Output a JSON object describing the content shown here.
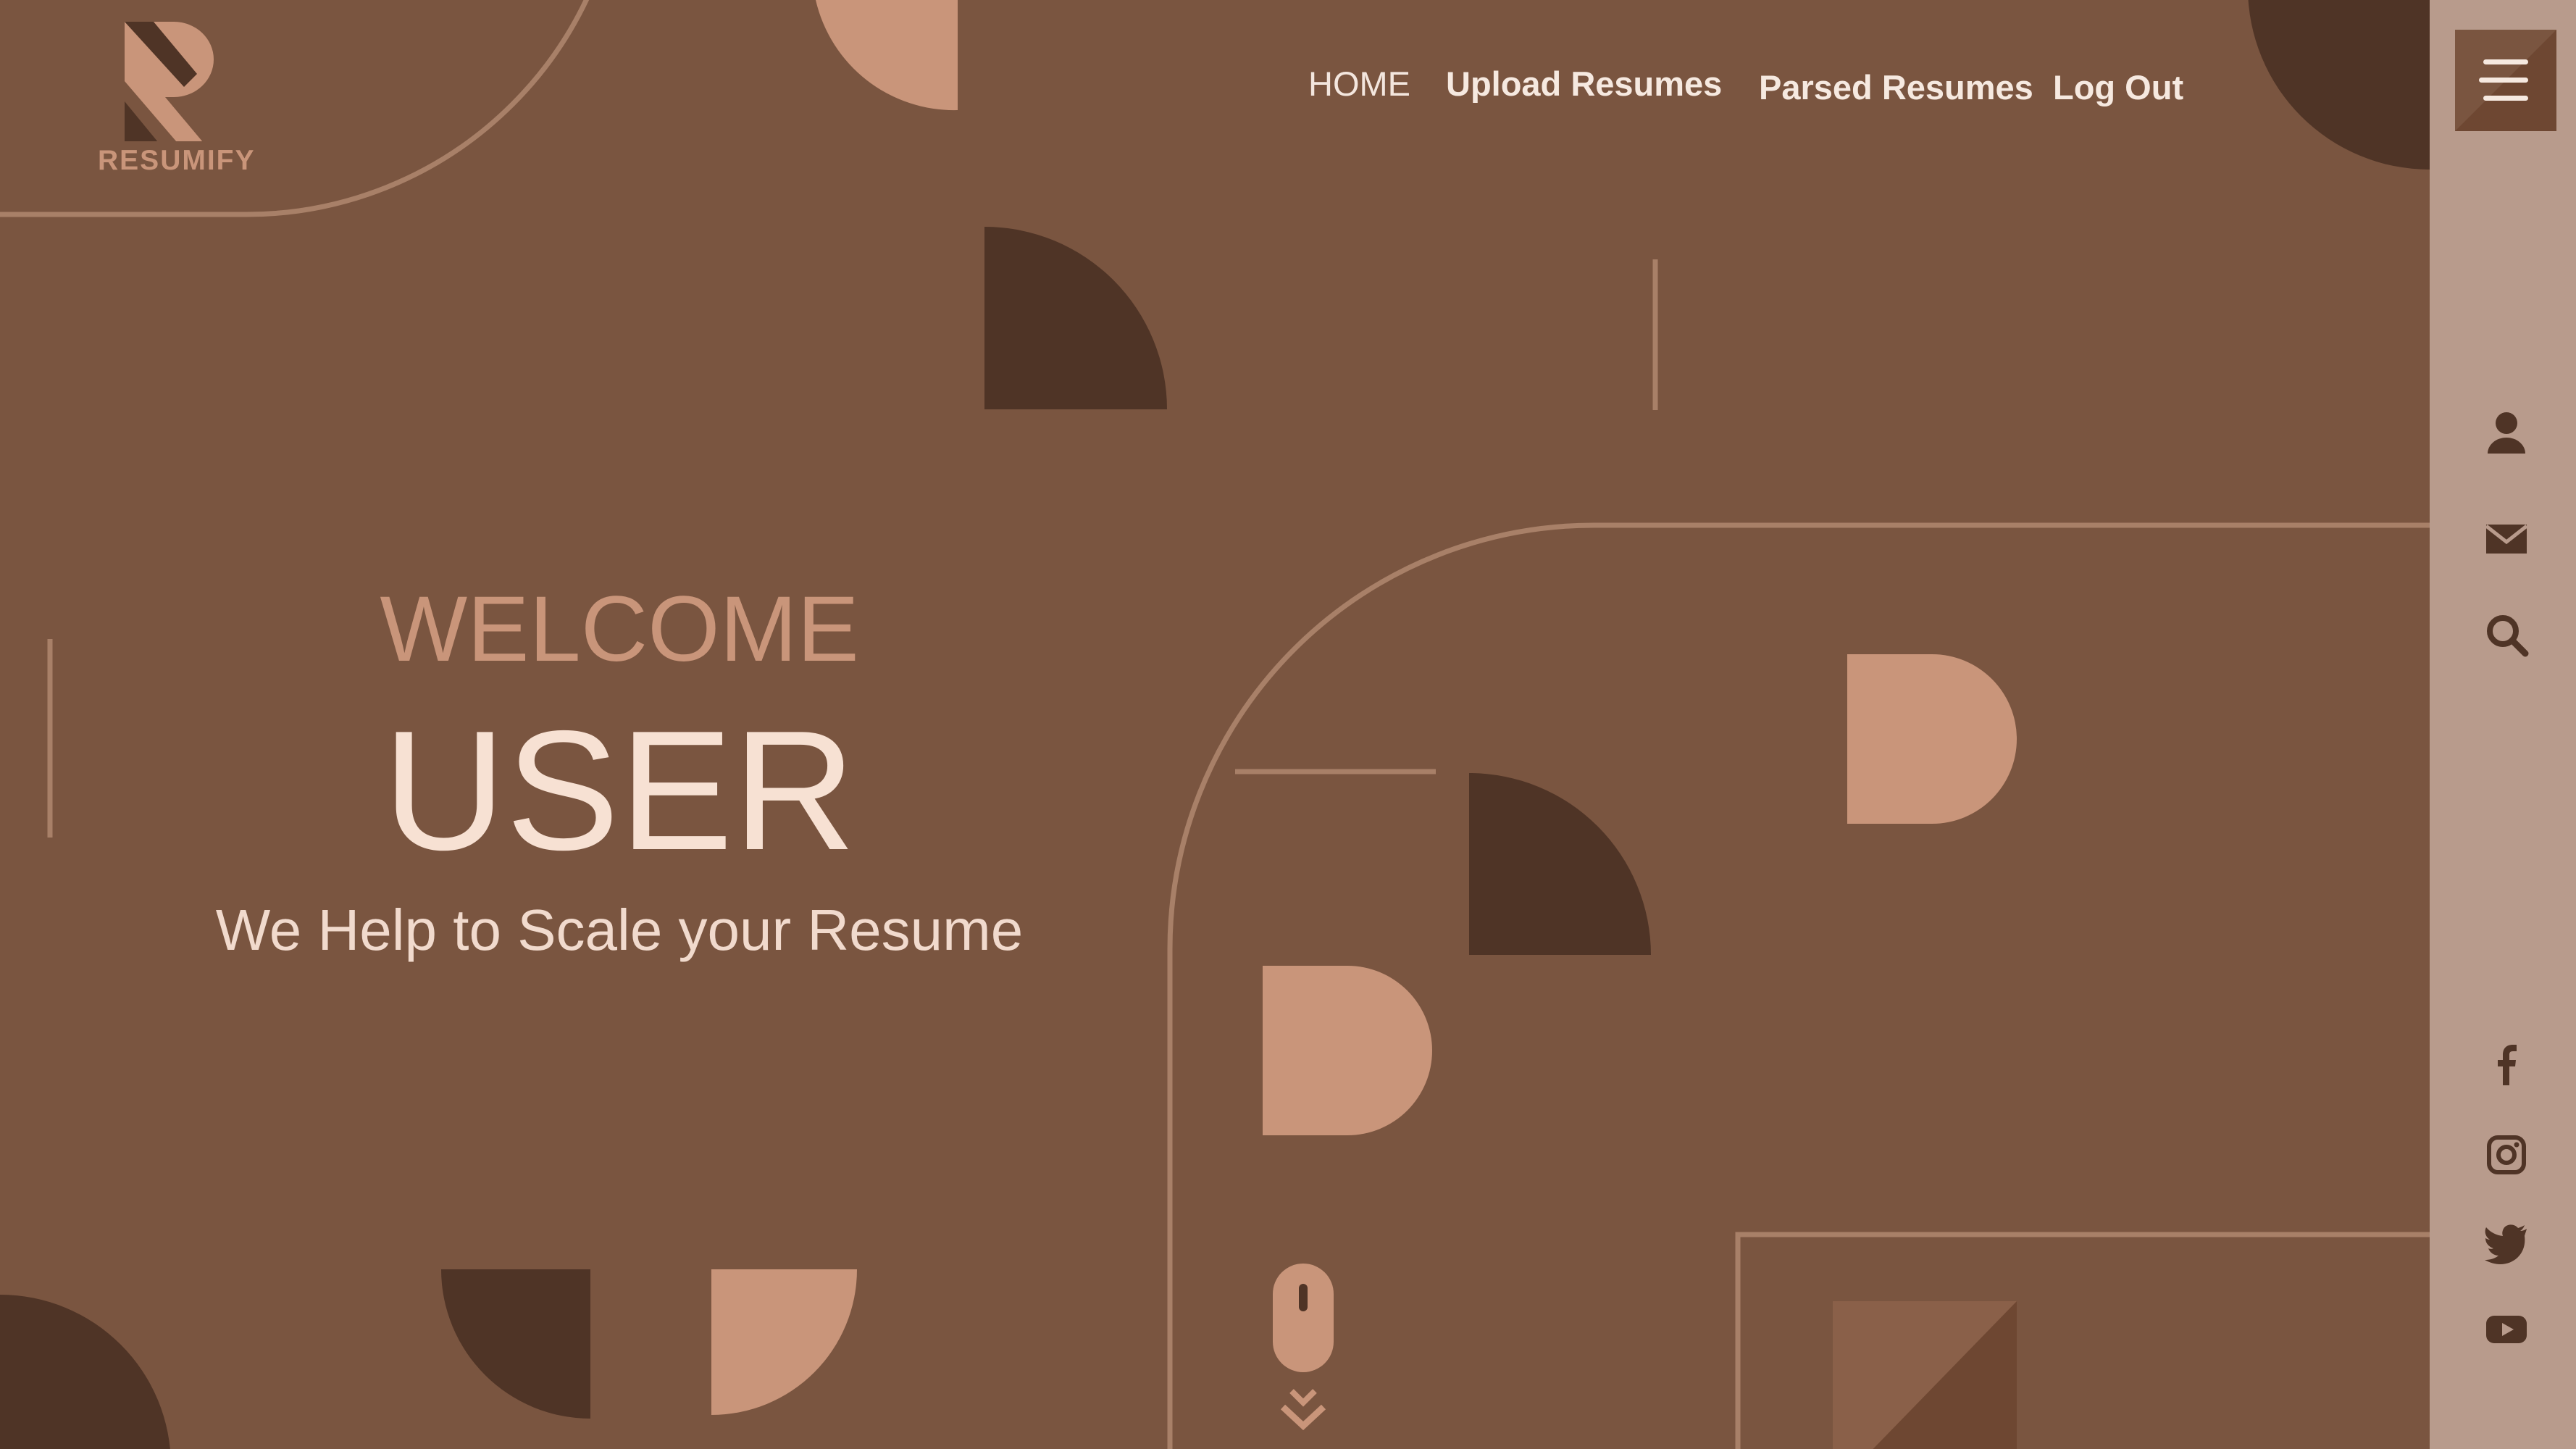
{
  "brand": {
    "name": "RESUMIFY",
    "logo_icon": "resumify-r-logo-icon"
  },
  "nav": {
    "home": "HOME",
    "upload": "Upload Resumes",
    "parsed": "Parsed Resumes",
    "logout": "Log Out"
  },
  "hero": {
    "welcome": "WELCOME",
    "user": "USER",
    "tagline": "We Help to Scale your Resume"
  },
  "sidebar": {
    "menu_icon": "hamburger-menu-icon",
    "top_icons": [
      "user-icon",
      "mail-icon",
      "search-icon"
    ],
    "social_icons": [
      "facebook-icon",
      "instagram-icon",
      "twitter-icon",
      "youtube-icon"
    ]
  },
  "scroll_indicator": {
    "icon": "mouse-scroll-icon"
  },
  "colors": {
    "background": "#7a5540",
    "dark_accent": "#4f3426",
    "light_accent": "#c9957a",
    "sidebar": "#b89b8c",
    "text_light": "#f7e1d3"
  }
}
